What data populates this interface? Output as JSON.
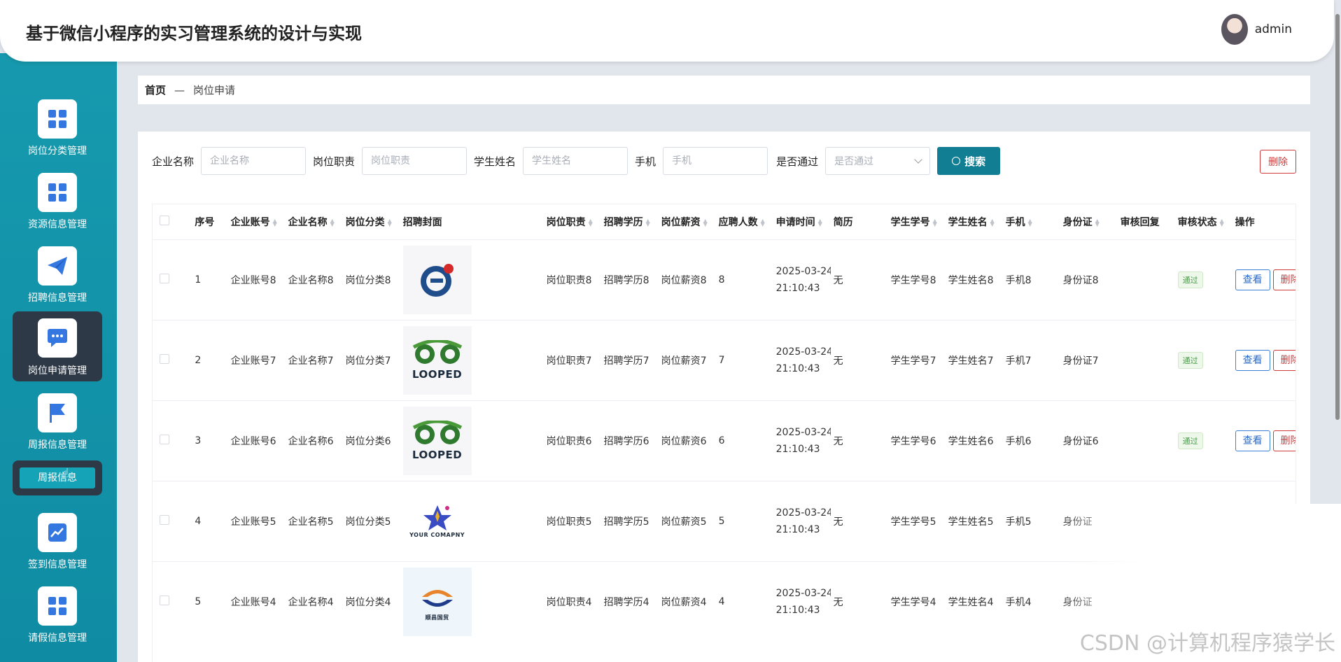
{
  "header": {
    "title": "基于微信小程序的实习管理系统的设计与实现",
    "user": "admin"
  },
  "sidebar": {
    "items": [
      {
        "label": "岗位分类管理",
        "icon": "grid-icon"
      },
      {
        "label": "资源信息管理",
        "icon": "grid-icon"
      },
      {
        "label": "招聘信息管理",
        "icon": "paper-plane-icon"
      },
      {
        "label": "岗位申请管理",
        "icon": "chat-icon",
        "active": true
      },
      {
        "label": "周报信息管理",
        "icon": "flag-icon"
      },
      {
        "label": "签到信息管理",
        "icon": "chart-icon"
      },
      {
        "label": "请假信息管理",
        "icon": "grid-icon"
      }
    ],
    "submenu": {
      "label": "周报信息"
    }
  },
  "breadcrumb": {
    "home": "首页",
    "separator": "—",
    "current": "岗位申请"
  },
  "filters": [
    {
      "label": "企业名称",
      "placeholder": "企业名称"
    },
    {
      "label": "岗位职责",
      "placeholder": "岗位职责"
    },
    {
      "label": "学生姓名",
      "placeholder": "学生姓名"
    },
    {
      "label": "手机",
      "placeholder": "手机"
    }
  ],
  "select": {
    "label": "是否通过",
    "placeholder": "是否通过"
  },
  "search_button": "搜索",
  "delete_button": "删除",
  "table": {
    "columns": [
      "序号",
      "企业账号",
      "企业名称",
      "岗位分类",
      "招聘封面",
      "岗位职责",
      "招聘学历",
      "岗位薪资",
      "应聘人数",
      "申请时间",
      "简历",
      "学生学号",
      "学生姓名",
      "手机",
      "身份证",
      "审核回复",
      "审核状态",
      "操作"
    ],
    "rows": [
      {
        "no": "1",
        "account": "企业账号8",
        "company": "企业名称8",
        "category": "岗位分类8",
        "cover": "ei-logo",
        "duty": "岗位职责8",
        "edu": "招聘学历8",
        "salary": "岗位薪资8",
        "count": "8",
        "date": "2025-03-24",
        "time": "21:10:43",
        "resume": "无",
        "sid": "学生学号8",
        "sname": "学生姓名8",
        "phone": "手机8",
        "idcard": "身份证8",
        "status": "通过",
        "view": "查看",
        "del": "删除"
      },
      {
        "no": "2",
        "account": "企业账号7",
        "company": "企业名称7",
        "category": "岗位分类7",
        "cover": "LOOPED",
        "duty": "岗位职责7",
        "edu": "招聘学历7",
        "salary": "岗位薪资7",
        "count": "7",
        "date": "2025-03-24",
        "time": "21:10:43",
        "resume": "无",
        "sid": "学生学号7",
        "sname": "学生姓名7",
        "phone": "手机7",
        "idcard": "身份证7",
        "status": "通过",
        "view": "查看",
        "del": "删除"
      },
      {
        "no": "3",
        "account": "企业账号6",
        "company": "企业名称6",
        "category": "岗位分类6",
        "cover": "LOOPED",
        "duty": "岗位职责6",
        "edu": "招聘学历6",
        "salary": "岗位薪资6",
        "count": "6",
        "date": "2025-03-24",
        "time": "21:10:43",
        "resume": "无",
        "sid": "学生学号6",
        "sname": "学生姓名6",
        "phone": "手机6",
        "idcard": "身份证6",
        "status": "通过",
        "view": "查看",
        "del": "删除"
      },
      {
        "no": "4",
        "account": "企业账号5",
        "company": "企业名称5",
        "category": "岗位分类5",
        "cover": "YOUR COMAPNY",
        "duty": "岗位职责5",
        "edu": "招聘学历5",
        "salary": "岗位薪资5",
        "count": "5",
        "date": "2025-03-24",
        "time": "21:10:43",
        "resume": "无",
        "sid": "学生学号5",
        "sname": "学生姓名5",
        "phone": "手机5",
        "idcard": "身份证",
        "status": "",
        "view": "",
        "del": ""
      },
      {
        "no": "5",
        "account": "企业账号4",
        "company": "企业名称4",
        "category": "岗位分类4",
        "cover": "顺昌国贸",
        "duty": "岗位职责4",
        "edu": "招聘学历4",
        "salary": "岗位薪资4",
        "count": "4",
        "date": "2025-03-24",
        "time": "21:10:43",
        "resume": "无",
        "sid": "学生学号4",
        "sname": "学生姓名4",
        "phone": "手机4",
        "idcard": "身份证",
        "status": "",
        "view": "",
        "del": ""
      }
    ]
  },
  "watermark": "CSDN @计算机程序猿学长",
  "colors": {
    "sidebar": "#1699ae",
    "primary": "#127e93",
    "danger": "#d03a3a"
  }
}
